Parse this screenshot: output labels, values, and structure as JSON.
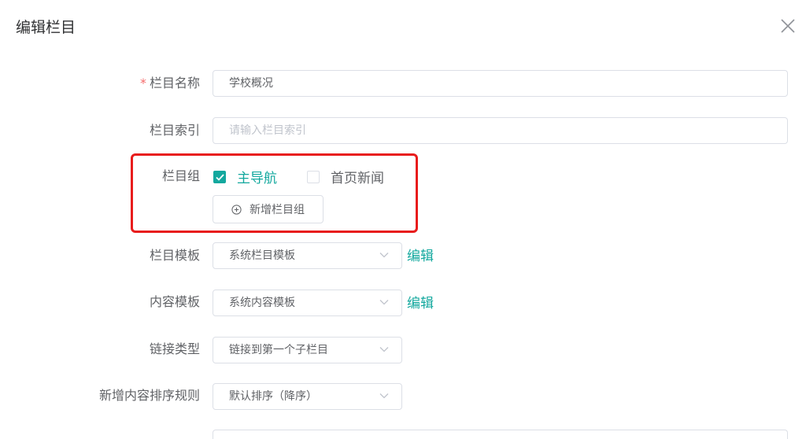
{
  "dialog": {
    "title": "编辑栏目"
  },
  "form": {
    "name": {
      "label": "栏目名称",
      "required_mark": "*",
      "value": "学校概况"
    },
    "index": {
      "label": "栏目索引",
      "placeholder": "请输入栏目索引"
    },
    "group": {
      "label": "栏目组",
      "options": [
        {
          "label": "主导航",
          "checked": true
        },
        {
          "label": "首页新闻",
          "checked": false
        }
      ],
      "add_button": "新增栏目组"
    },
    "column_template": {
      "label": "栏目模板",
      "value": "系统栏目模板",
      "edit_link": "编辑"
    },
    "content_template": {
      "label": "内容模板",
      "value": "系统内容模板",
      "edit_link": "编辑"
    },
    "link_type": {
      "label": "链接类型",
      "value": "链接到第一个子栏目"
    },
    "sort_rule": {
      "label": "新增内容排序规则",
      "value": "默认排序（降序）"
    }
  },
  "colors": {
    "accent": "#13a89e",
    "required": "#f56c6c",
    "highlight_border": "#e81c1c"
  },
  "icons": {
    "close": "close-icon",
    "check": "check-icon",
    "add": "plus-circle-icon",
    "dropdown": "chevron-down-icon"
  }
}
